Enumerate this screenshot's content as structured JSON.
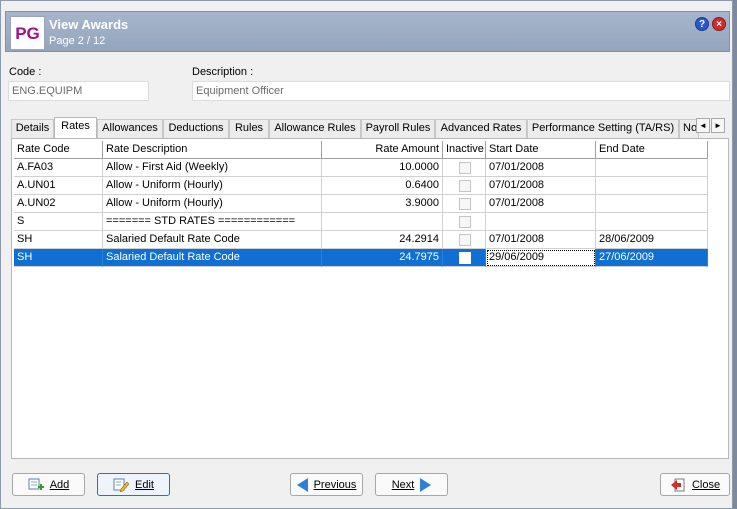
{
  "window": {
    "logo": "PG",
    "title": "View Awards",
    "subtitle": "Page 2 / 12",
    "help_glyph": "?",
    "close_glyph": "×"
  },
  "fields": {
    "code_label": "Code :",
    "code_value": "ENG.EQUIPM",
    "description_label": "Description :",
    "description_value": "Equipment Officer"
  },
  "tabs": [
    "Details",
    "Rates",
    "Allowances",
    "Deductions",
    "Rules",
    "Allowance Rules",
    "Payroll Rules",
    "Advanced Rates",
    "Performance Setting (TA/RS)",
    "No"
  ],
  "active_tab": "Rates",
  "tab_scroll": {
    "left": "◄",
    "right": "►"
  },
  "grid": {
    "columns": [
      "Rate Code",
      "Rate Description",
      "Rate Amount",
      "Inactive",
      "Start Date",
      "End Date"
    ],
    "rows": [
      {
        "code": "A.FA03",
        "description": "Allow - First Aid (Weekly)",
        "amount": "10.0000",
        "inactive": false,
        "start": "07/01/2008",
        "end": ""
      },
      {
        "code": "A.UN01",
        "description": "Allow - Uniform (Hourly)",
        "amount": "0.6400",
        "inactive": false,
        "start": "07/01/2008",
        "end": ""
      },
      {
        "code": "A.UN02",
        "description": "Allow - Uniform (Hourly)",
        "amount": "3.9000",
        "inactive": false,
        "start": "07/01/2008",
        "end": ""
      },
      {
        "code": "S",
        "description": "======= STD RATES ============",
        "amount": "",
        "inactive": false,
        "start": "",
        "end": ""
      },
      {
        "code": "SH",
        "description": "Salaried Default Rate Code",
        "amount": "24.2914",
        "inactive": false,
        "start": "07/01/2008",
        "end": "28/06/2009"
      },
      {
        "code": "SH",
        "description": "Salaried Default Rate Code",
        "amount": "24.7975",
        "inactive": false,
        "start": "29/06/2009",
        "end": "27/06/2009"
      }
    ],
    "selected_row": 5
  },
  "buttons": {
    "add": "Add",
    "edit": "Edit",
    "previous": "Previous",
    "next": "Next",
    "close": "Close"
  },
  "colors": {
    "selection": "#0f6fd2",
    "title_bar": "#a6b6cc",
    "logo_text": "#a10f8a"
  }
}
